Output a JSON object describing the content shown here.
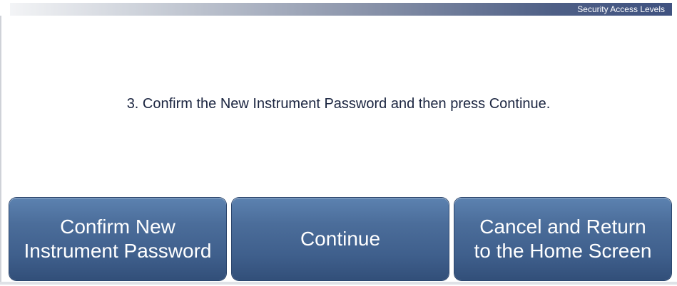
{
  "header": {
    "title": "Security Access Levels"
  },
  "main": {
    "instruction": "3. Confirm the New Instrument Password and then press Continue."
  },
  "buttons": {
    "confirm": {
      "line1": "Confirm New",
      "line2": "Instrument Password"
    },
    "continue": {
      "label": "Continue"
    },
    "cancel": {
      "line1": "Cancel and Return",
      "line2": "to the Home Screen"
    }
  },
  "colors": {
    "button_blue": "#4b6d9a",
    "header_gradient_end": "#3f5280",
    "instruction_text": "#1b2540"
  }
}
